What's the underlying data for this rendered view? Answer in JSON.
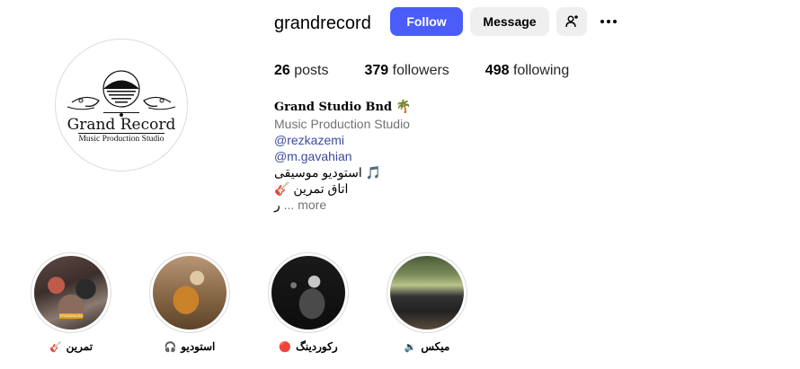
{
  "profile": {
    "username": "grandrecord",
    "follow_label": "Follow",
    "message_label": "Message",
    "add_user_icon": "add-user-icon",
    "more_icon": "more-horizontal-icon"
  },
  "avatar": {
    "logo_title": "Grand Record",
    "logo_subtitle": "Music Production Studio"
  },
  "stats": {
    "posts_count": "26",
    "posts_label": "posts",
    "followers_count": "379",
    "followers_label": "followers",
    "following_count": "498",
    "following_label": "following"
  },
  "bio": {
    "name": "Grand Studio Bnd",
    "name_emoji": "🌴",
    "category": "Music Production Studio",
    "mention1": "@rezkazemi",
    "mention2": "@m.gavahian",
    "line1_text": "استودیو موسیقی",
    "line1_emoji": "🎵",
    "line2_text": "اتاق تمرین",
    "line2_emoji": "🎸",
    "line3_text": "ر",
    "more_label": "... more"
  },
  "highlights": [
    {
      "label": "تمرین",
      "emoji": "🎸",
      "badge": "GRANDMUSIC"
    },
    {
      "label": "استودیو",
      "emoji": "🎧"
    },
    {
      "label": "رکوردینگ",
      "emoji": "🔴"
    },
    {
      "label": "میکس",
      "emoji": "🔉"
    }
  ],
  "colors": {
    "follow_button": "#4a5df9",
    "secondary_button": "#efefef",
    "link": "#3b4aa1",
    "muted_text": "#737373"
  }
}
